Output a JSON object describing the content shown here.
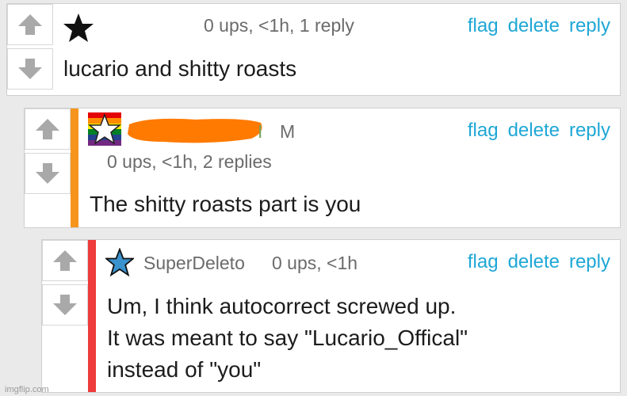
{
  "actions": {
    "flag": "flag",
    "delete": "delete",
    "reply": "reply"
  },
  "comments": [
    {
      "meta": "0 ups, <1h, 1 reply",
      "text_lines": [
        "lucario and shitty roasts"
      ]
    },
    {
      "username_suffix": "M",
      "meta": "0 ups, <1h, 2 replies",
      "text_lines": [
        "The shitty roasts part is you"
      ],
      "stripe_color": "#f7941d",
      "redaction_color": "#ff7a00"
    },
    {
      "username": "SuperDeleto",
      "meta": "0 ups, <1h",
      "text_lines": [
        "Um, I think autocorrect screwed up.",
        "It was meant to say \"Lucario_Offical\"",
        "instead of \"you\""
      ],
      "stripe_color": "#ef3b3b",
      "star_color": "#3a93cf"
    }
  ],
  "watermark": "imgflip.com",
  "colors": {
    "link": "#1ea7d6",
    "meta": "#6b6b6b",
    "background": "#eaeaea"
  }
}
